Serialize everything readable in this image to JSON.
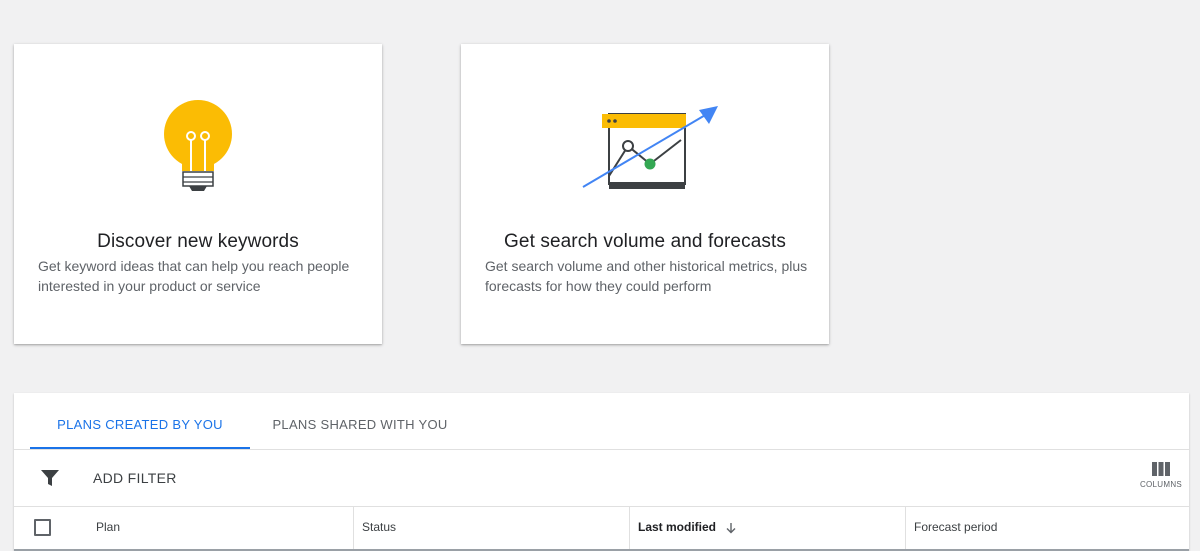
{
  "cards": [
    {
      "title": "Discover new keywords",
      "description": "Get keyword ideas that can help you reach people interested in your product or service",
      "icon": "lightbulb-icon"
    },
    {
      "title": "Get search volume and forecasts",
      "description": "Get search volume and other historical metrics, plus forecasts for how they could perform",
      "icon": "trend-chart-icon"
    }
  ],
  "tabs": [
    {
      "label": "PLANS CREATED BY YOU",
      "active": true
    },
    {
      "label": "PLANS SHARED WITH YOU",
      "active": false
    }
  ],
  "toolbar": {
    "filter_icon": "filter-icon",
    "add_filter_label": "ADD FILTER",
    "columns_icon": "columns-icon",
    "columns_label": "COLUMNS"
  },
  "table": {
    "columns": [
      "Plan",
      "Status",
      "Last modified",
      "Forecast period"
    ],
    "sorted_column": "Last modified",
    "sort_direction": "descending"
  },
  "colors": {
    "accent": "#1a73e8",
    "bulb": "#fbbc04",
    "chart_header": "#fbbc04",
    "chart_point": "#34a853",
    "background": "#f1f1f2"
  }
}
